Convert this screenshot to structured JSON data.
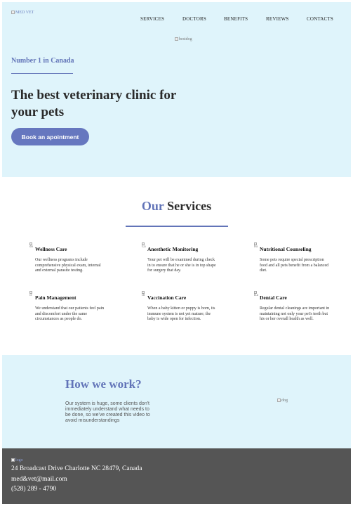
{
  "header": {
    "logo_alt": "MED VET",
    "nav": [
      "SERVICES",
      "DOCTORS",
      "BENEFITS",
      "REVIEWS",
      "CONTACTS"
    ]
  },
  "hero": {
    "image_alt": "bestdog",
    "tagline": "Number 1 in Canada",
    "title": "The best veterinary clinic for your pets",
    "button": "Book an apointment"
  },
  "services": {
    "title_accent": "Our",
    "title_rest": "Services",
    "items": [
      {
        "icon_alt": "do",
        "name": "Wellness Care",
        "desc": "Our wellness programs include comprehensive physical exam, internal and external parasite testing."
      },
      {
        "icon_alt": "Ca",
        "name": "Anesthetic Monitoring",
        "desc": "Your pet will be examined during check in to ensure that he or she is in top shape for surgery that day."
      },
      {
        "icon_alt": "bu",
        "name": "Nutritional Counseling",
        "desc": "Some pets require special prescription food and all pets benefit from a balanced diet."
      },
      {
        "icon_alt": "cr",
        "name": "Pain Management",
        "desc": "We understand that our patients feel pain and discomfort under the same circumstances as people do."
      },
      {
        "icon_alt": "Ill",
        "name": "Vaccination Care",
        "desc": "When a baby kitten or puppy is born, its immune system is not yet mature; the baby is wide open for infection."
      },
      {
        "icon_alt": "Ka",
        "name": "Dental Care",
        "desc": "Regular dental cleanings are important in maintaining not only your pet's teeth but his or her overall health as well."
      }
    ]
  },
  "how": {
    "title": "How we work?",
    "text": "Our system is huge, some clients don't immediately understand what needs to be done, so we've created this video to avoid misunderstandings",
    "image_alt": "dog"
  },
  "footer": {
    "logo_alt": "logo",
    "address": "24 Broadcast Drive Charlotte NC 28479, Canada",
    "email": "med&vet@mail.com",
    "phone": "(528) 289 - 4790"
  },
  "colors": {
    "accent": "#6274b8",
    "hero_bg": "#dff4fb",
    "footer_bg": "#555555"
  }
}
